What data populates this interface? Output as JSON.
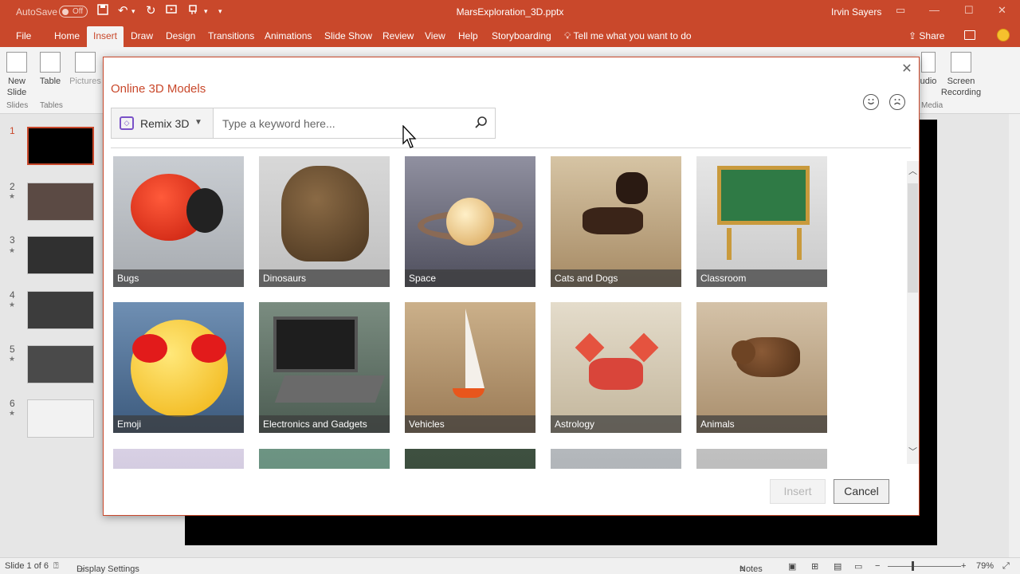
{
  "titlebar": {
    "autosave_label": "AutoSave",
    "autosave_state": "Off",
    "doc_title": "MarsExploration_3D.pptx",
    "user": "Irvin Sayers"
  },
  "tabs": [
    "File",
    "Home",
    "Insert",
    "Draw",
    "Design",
    "Transitions",
    "Animations",
    "Slide Show",
    "Review",
    "View",
    "Help",
    "Storyboarding"
  ],
  "active_tab": "Insert",
  "tell_me": "Tell me what you want to do",
  "share_label": "Share",
  "ribbon": {
    "new_slide": "New",
    "new_slide_2": "Slide",
    "table": "Table",
    "pictures": "Pictures",
    "group_slides": "Slides",
    "group_tables": "Tables",
    "audio": "udio",
    "screen_recording_1": "Screen",
    "screen_recording_2": "Recording",
    "group_media": "Media"
  },
  "slides": [
    "1",
    "2",
    "3",
    "4",
    "5",
    "6"
  ],
  "dialog": {
    "title": "Online 3D Models",
    "source": "Remix 3D",
    "search_placeholder": "Type a keyword here...",
    "insert_label": "Insert",
    "cancel_label": "Cancel"
  },
  "categories": [
    "Bugs",
    "Dinosaurs",
    "Space",
    "Cats and Dogs",
    "Classroom",
    "Emoji",
    "Electronics and Gadgets",
    "Vehicles",
    "Astrology",
    "Animals"
  ],
  "status": {
    "slide_info": "Slide 1 of 6",
    "display_settings": "Display Settings",
    "notes": "Notes",
    "zoom": "79%"
  },
  "colors": {
    "accent": "#c9482b",
    "remix": "#7a52c8"
  }
}
